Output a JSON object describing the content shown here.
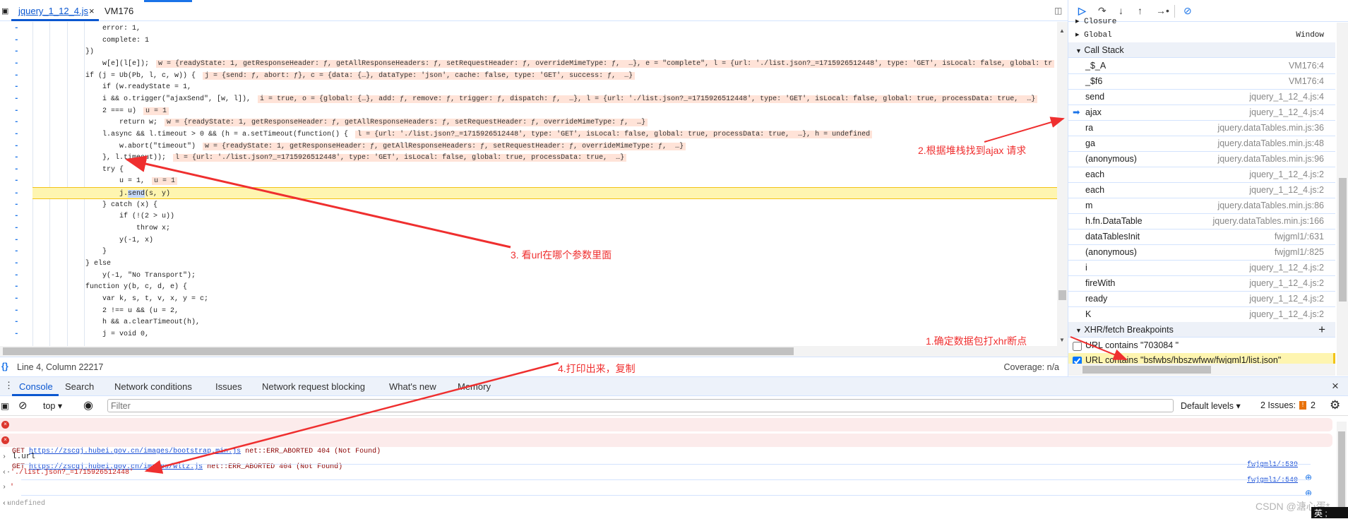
{
  "editor_tabs": [
    {
      "label": "jquery_1_12_4.js",
      "close": "×",
      "active": true
    },
    {
      "label": "VM176"
    }
  ],
  "code_lines": [
    {
      "i": 1,
      "c": "error: 1,"
    },
    {
      "i": 1,
      "c": "complete: 1"
    },
    {
      "i": 0,
      "c": "})"
    },
    {
      "i": 1,
      "c": "w[e](l[e]);",
      "a": "w = {readyState: 1, getResponseHeader: ƒ, getAllResponseHeaders: ƒ, setRequestHeader: ƒ, overrideMimeType: ƒ,  …}, e = \"complete\", l = {url: './list.json?_=1715926512448', type: 'GET', isLocal: false, global: tr"
    },
    {
      "i": 0,
      "c": "if (j = Ub(Pb, l, c, w)) {",
      "a": "j = {send: ƒ, abort: ƒ}, c = {data: {…}, dataType: 'json', cache: false, type: 'GET', success: ƒ,  …}"
    },
    {
      "i": 1,
      "c": "if (w.readyState = 1,"
    },
    {
      "i": 1,
      "c": "i && o.trigger(\"ajaxSend\", [w, l]),",
      "a": "i = true, o = {global: {…}, add: ƒ, remove: ƒ, trigger: ƒ, dispatch: ƒ,  …}, l = {url: './list.json?_=1715926512448', type: 'GET', isLocal: false, global: true, processData: true,  …}"
    },
    {
      "i": 1,
      "c": "2 === u)",
      "a": "u = 1"
    },
    {
      "i": 2,
      "c": "return w;",
      "a": "w = {readyState: 1, getResponseHeader: ƒ, getAllResponseHeaders: ƒ, setRequestHeader: ƒ, overrideMimeType: ƒ,  …}"
    },
    {
      "i": 1,
      "c": "l.async && l.timeout > 0 && (h = a.setTimeout(function() {",
      "a": "l = {url: './list.json?_=1715926512448', type: 'GET', isLocal: false, global: true, processData: true,  …}, h = undefined"
    },
    {
      "i": 2,
      "c": "w.abort(\"timeout\")",
      "a": "w = {readyState: 1, getResponseHeader: ƒ, getAllResponseHeaders: ƒ, setRequestHeader: ƒ, overrideMimeType: ƒ,  …}"
    },
    {
      "i": 1,
      "c": "}, l.timeout));",
      "a": "l = {url: './list.json?_=1715926512448', type: 'GET', isLocal: false, global: true, processData: true,  …}"
    },
    {
      "i": 1,
      "c": "try {"
    },
    {
      "i": 2,
      "c": "u = 1,",
      "a": "u = 1"
    },
    {
      "i": 2,
      "c": "j.send(s, y)",
      "sel": "send",
      "current": true
    },
    {
      "i": 1,
      "c": "} catch (x) {"
    },
    {
      "i": 2,
      "c": "if (!(2 > u))"
    },
    {
      "i": 3,
      "c": "throw x;"
    },
    {
      "i": 2,
      "c": "y(-1, x)"
    },
    {
      "i": 1,
      "c": "}"
    },
    {
      "i": 0,
      "c": "} else"
    },
    {
      "i": 1,
      "c": "y(-1, \"No Transport\");"
    },
    {
      "i": 0,
      "c": "function y(b, c, d, e) {"
    },
    {
      "i": 1,
      "c": "var k, s, t, v, x, y = c;"
    },
    {
      "i": 1,
      "c": "2 !== u && (u = 2,"
    },
    {
      "i": 1,
      "c": "h && a.clearTimeout(h),"
    },
    {
      "i": 1,
      "c": "j = void 0,"
    }
  ],
  "status": {
    "position": "Line 4, Column 22217",
    "coverage": "Coverage: n/a"
  },
  "scope": {
    "closure": "Closure",
    "global": "Global",
    "global_value": "Window"
  },
  "call_stack": {
    "title": "Call Stack",
    "frames": [
      {
        "name": "_$_A",
        "loc": "VM176:4"
      },
      {
        "name": "_$f6",
        "loc": "VM176:4"
      },
      {
        "name": "send",
        "loc": "jquery_1_12_4.js:4"
      },
      {
        "name": "ajax",
        "loc": "jquery_1_12_4.js:4",
        "current": true
      },
      {
        "name": "ra",
        "loc": "jquery.dataTables.min.js:36"
      },
      {
        "name": "ga",
        "loc": "jquery.dataTables.min.js:48"
      },
      {
        "name": "(anonymous)",
        "loc": "jquery.dataTables.min.js:96"
      },
      {
        "name": "each",
        "loc": "jquery_1_12_4.js:2"
      },
      {
        "name": "each",
        "loc": "jquery_1_12_4.js:2"
      },
      {
        "name": "m",
        "loc": "jquery.dataTables.min.js:86"
      },
      {
        "name": "h.fn.DataTable",
        "loc": "jquery.dataTables.min.js:166"
      },
      {
        "name": "dataTablesInit",
        "loc": "fwjgml1/:631"
      },
      {
        "name": "(anonymous)",
        "loc": "fwjgml1/:825"
      },
      {
        "name": "i",
        "loc": "jquery_1_12_4.js:2"
      },
      {
        "name": "fireWith",
        "loc": "jquery_1_12_4.js:2"
      },
      {
        "name": "ready",
        "loc": "jquery_1_12_4.js:2"
      },
      {
        "name": "K",
        "loc": "jquery_1_12_4.js:2"
      }
    ]
  },
  "xhr": {
    "title": "XHR/fetch Breakpoints",
    "add": "+",
    "items": [
      {
        "label": "URL contains \"703084 \"",
        "checked": false
      },
      {
        "label": "URL contains \"bsfwbs/hbszwfww/fwjgml1/list.json\"",
        "checked": true
      }
    ]
  },
  "drawer_tabs": [
    "Console",
    "Search",
    "Network conditions",
    "Issues",
    "Network request blocking",
    "What's new",
    "Memory"
  ],
  "drawer_close": "×",
  "console_toolbar": {
    "context": "top ▾",
    "filter_placeholder": "Filter",
    "levels": "Default levels ▾",
    "issues_label": "2 Issues:",
    "issues_count": "2"
  },
  "console": {
    "errors": [
      {
        "method": "GET",
        "url": "https://zscqj.hubei.gov.cn/images/bootstrap.min.js",
        "msg": "net::ERR_ABORTED 404 (Not Found)",
        "src": "fwjgml1/:539"
      },
      {
        "method": "GET",
        "url": "https://zscqj.hubei.gov.cn/images/wltz.js",
        "msg": "net::ERR_ABORTED 404 (Not Found)",
        "src": "fwjgml1/:540"
      }
    ],
    "input1": "l.url",
    "result1": "'./list.json?_=1715926512448'",
    "input2": "'",
    "result2": "undefined"
  },
  "annotations": {
    "step1": "1.确定数据包打xhr断点",
    "step2": "2.根据堆栈找到ajax 请求",
    "step3": "3. 看url在哪个参数里面",
    "step4": "4.打印出来，复制",
    "color": "#ef2f2f"
  },
  "watermark": "CSDN @溏心蛋*",
  "ime": "英 ;"
}
